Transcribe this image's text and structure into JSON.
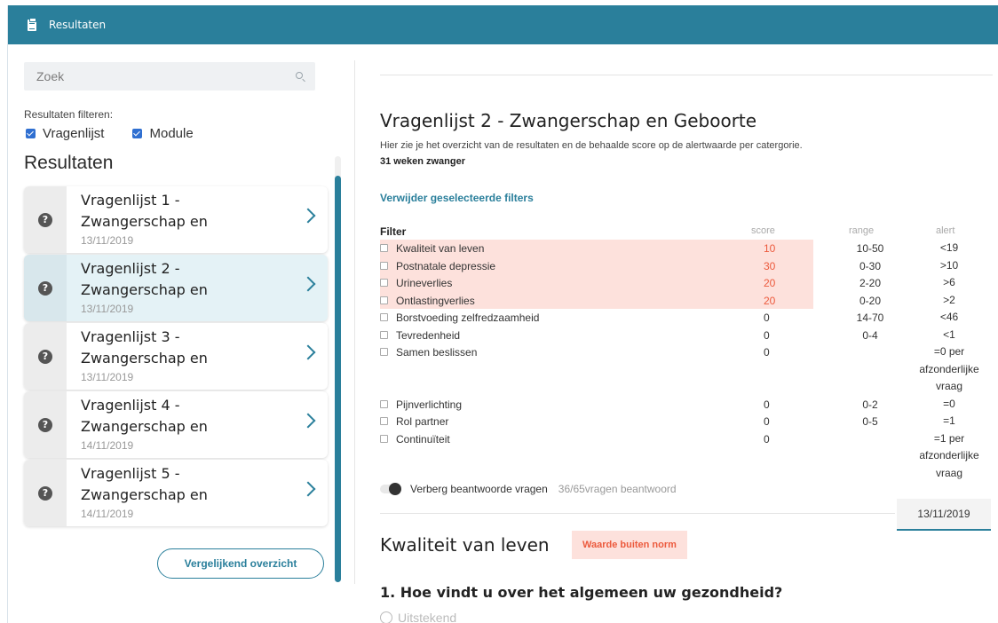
{
  "topbar": {
    "title": "Resultaten",
    "icon": "clipboard-icon",
    "color": "#2a7f9b"
  },
  "sidebar": {
    "search_placeholder": "Zoek",
    "filter_label": "Resultaten filteren:",
    "filters": [
      {
        "label": "Vragenlijst",
        "checked": true
      },
      {
        "label": "Module",
        "checked": true
      }
    ],
    "heading": "Resultaten",
    "items": [
      {
        "line1": "Vragenlijst 1 -",
        "line2": "Zwangerschap en",
        "date": "13/11/2019",
        "active": false
      },
      {
        "line1": "Vragenlijst 2 -",
        "line2": "Zwangerschap en",
        "date": "13/11/2019",
        "active": true
      },
      {
        "line1": "Vragenlijst 3 -",
        "line2": "Zwangerschap en",
        "date": "13/11/2019",
        "active": false
      },
      {
        "line1": "Vragenlijst 4 -",
        "line2": "Zwangerschap en",
        "date": "14/11/2019",
        "active": false
      },
      {
        "line1": "Vragenlijst 5 -",
        "line2": "Zwangerschap en",
        "date": "14/11/2019",
        "active": false
      }
    ],
    "compare_button": "Vergelijkend overzicht"
  },
  "main": {
    "title": "Vragenlijst 2 - Zwangerschap en Geboorte",
    "subtitle": "Hier zie je het overzicht van de resultaten en de behaalde score op de alertwaarde per catergorie.",
    "weeks": "31 weken zwanger",
    "remove_filters": "Verwijder geselecteerde filters",
    "table": {
      "headers": {
        "filter": "Filter",
        "score": "score",
        "range": "range",
        "alert": "alert"
      },
      "rows": [
        {
          "label": "Kwaliteit van leven",
          "score": "10",
          "range": "10-50",
          "alert": "<19",
          "highlight": true
        },
        {
          "label": "Postnatale depressie",
          "score": "30",
          "range": "0-30",
          "alert": ">10",
          "highlight": true
        },
        {
          "label": "Urineverlies",
          "score": "20",
          "range": "2-20",
          "alert": ">6",
          "highlight": true
        },
        {
          "label": "Ontlastingverlies",
          "score": "20",
          "range": "0-20",
          "alert": ">2",
          "highlight": true
        },
        {
          "label": "Borstvoeding zelfredzaamheid",
          "score": "0",
          "range": "14-70",
          "alert": "<46",
          "highlight": false
        },
        {
          "label": "Tevredenheid",
          "score": "0",
          "range": "0-4",
          "alert": "<1",
          "highlight": false
        },
        {
          "label": "Samen beslissen",
          "score": "0",
          "range": "",
          "alert": "=0 per afzonderlijke vraag",
          "highlight": false
        },
        {
          "label": "Pijnverlichting",
          "score": "0",
          "range": "0-2",
          "alert": "=0",
          "highlight": false
        },
        {
          "label": "Rol partner",
          "score": "0",
          "range": "0-5",
          "alert": "=1",
          "highlight": false
        },
        {
          "label": "Continuïteit",
          "score": "0",
          "range": "",
          "alert": "=1 per afzonderlijke vraag",
          "highlight": false
        }
      ]
    },
    "toggle_label": "Verberg beantwoorde vragen",
    "answered_count": "36/65vragen beantwoord",
    "date_selected": "13/11/2019",
    "section_title": "Kwaliteit van leven",
    "badge": "Waarde buiten norm",
    "question": "1. Hoe vindt u over het algemeen uw gezondheid?",
    "option_peek": "Uitstekend"
  }
}
